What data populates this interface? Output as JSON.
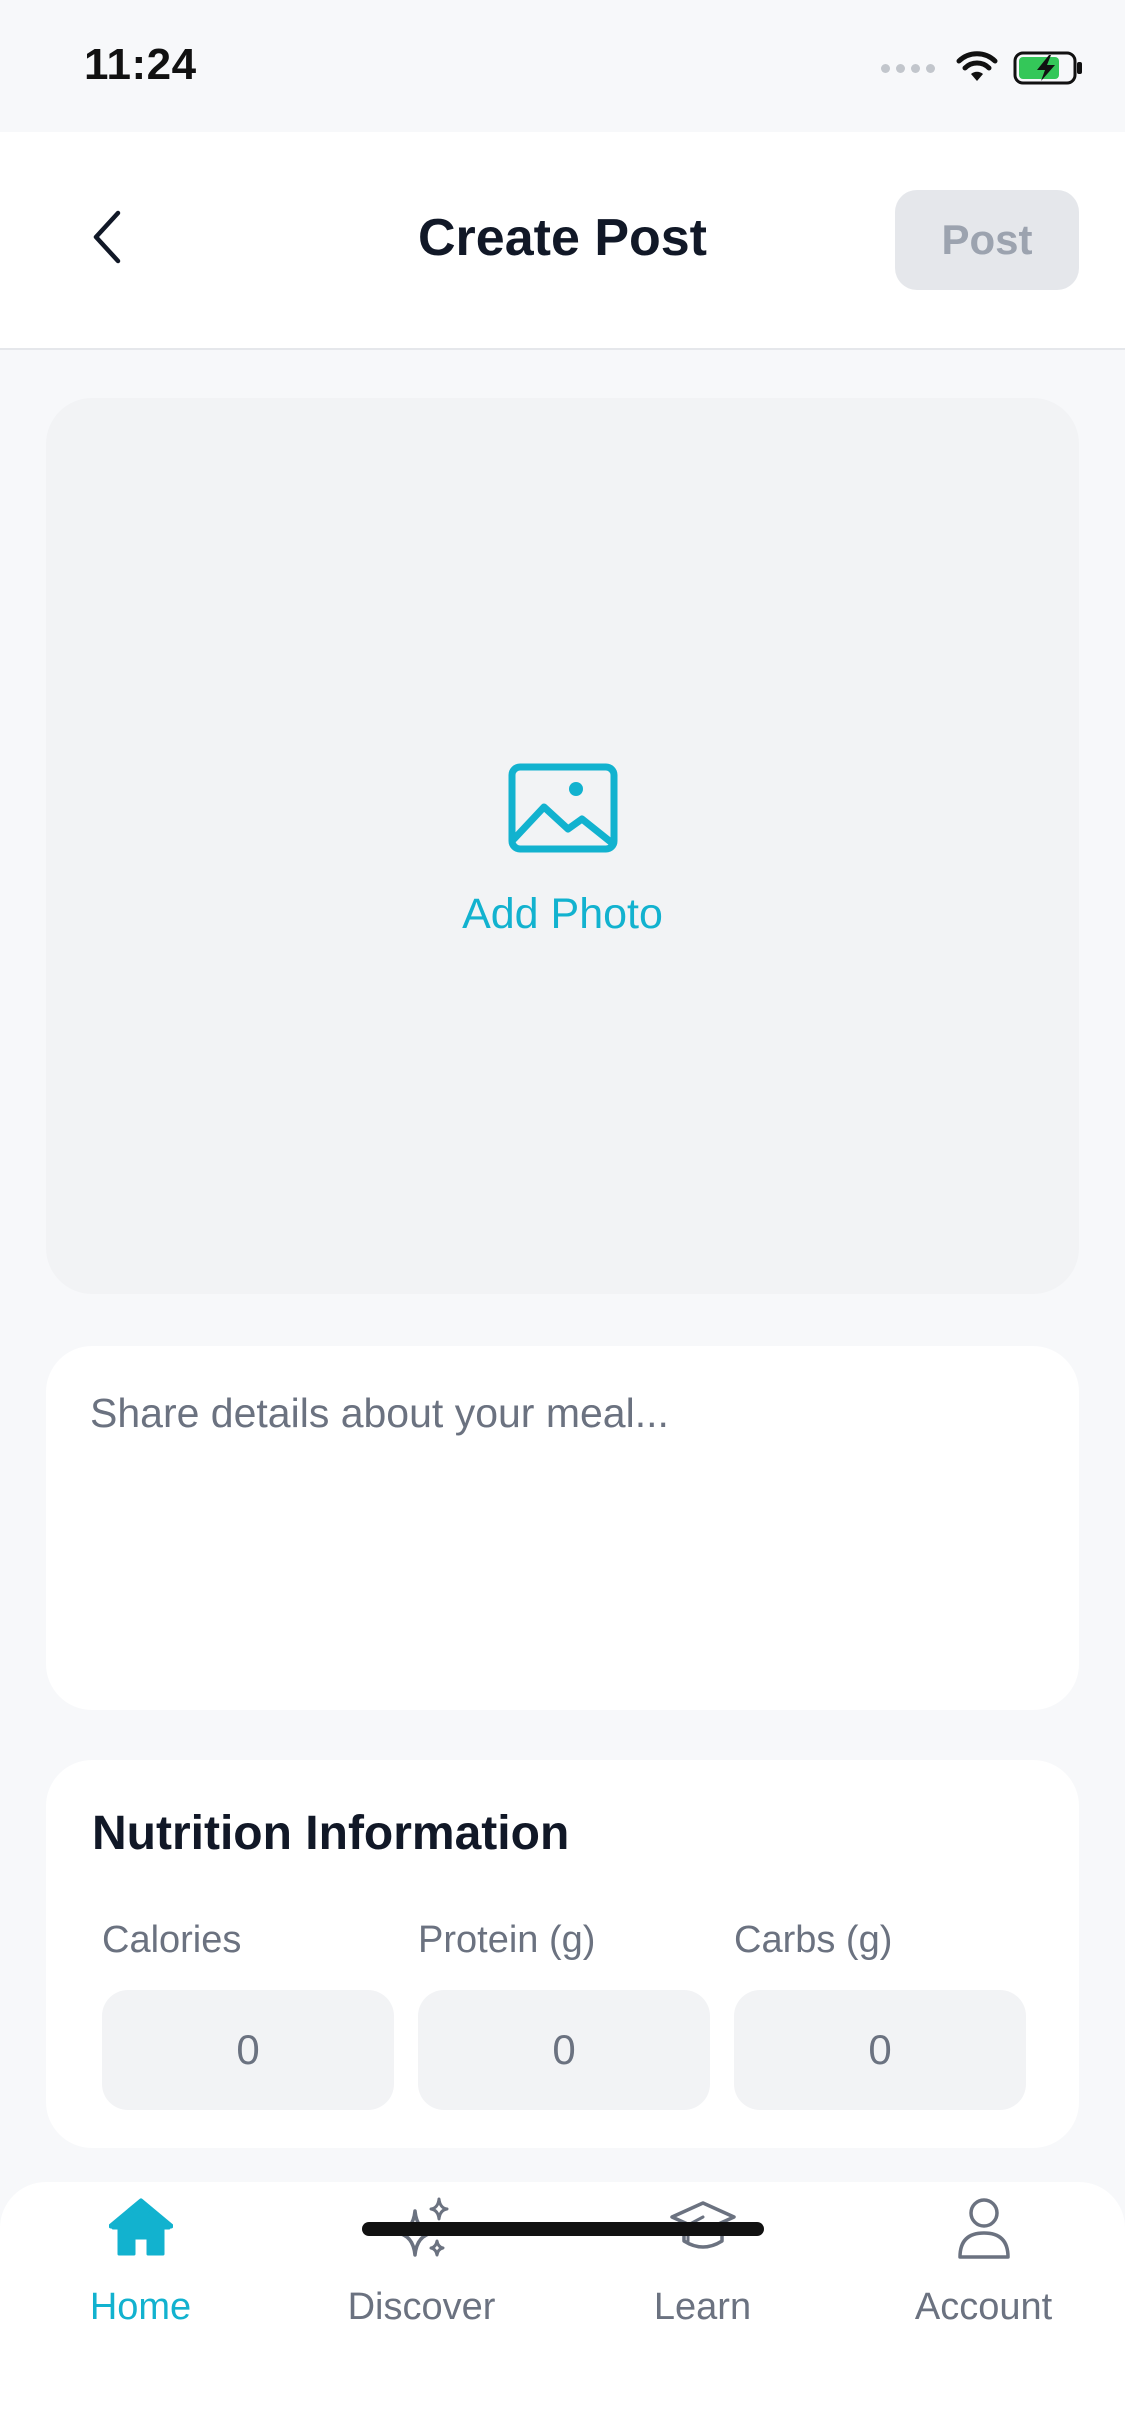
{
  "status_bar": {
    "time": "11:24",
    "battery_color": "#34C759"
  },
  "header": {
    "title": "Create Post",
    "post_label": "Post",
    "back_icon": "chevron-left-icon"
  },
  "photo": {
    "label": "Add Photo",
    "icon": "image-icon",
    "accent": "#12B2CF"
  },
  "description": {
    "placeholder": "Share details about your meal...",
    "value": ""
  },
  "nutrition": {
    "title": "Nutrition Information",
    "fields": [
      {
        "label": "Calories",
        "value": "0"
      },
      {
        "label": "Protein (g)",
        "value": "0"
      },
      {
        "label": "Carbs (g)",
        "value": "0"
      }
    ]
  },
  "tabs": [
    {
      "label": "Home",
      "icon": "home-icon",
      "active": true
    },
    {
      "label": "Discover",
      "icon": "sparkles-icon",
      "active": false
    },
    {
      "label": "Learn",
      "icon": "graduation-cap-icon",
      "active": false
    },
    {
      "label": "Account",
      "icon": "user-icon",
      "active": false
    }
  ],
  "colors": {
    "accent": "#12B2CF",
    "background": "#F7F8FA",
    "disabled_button": "#E5E7EB",
    "muted_text": "#6B7280"
  }
}
